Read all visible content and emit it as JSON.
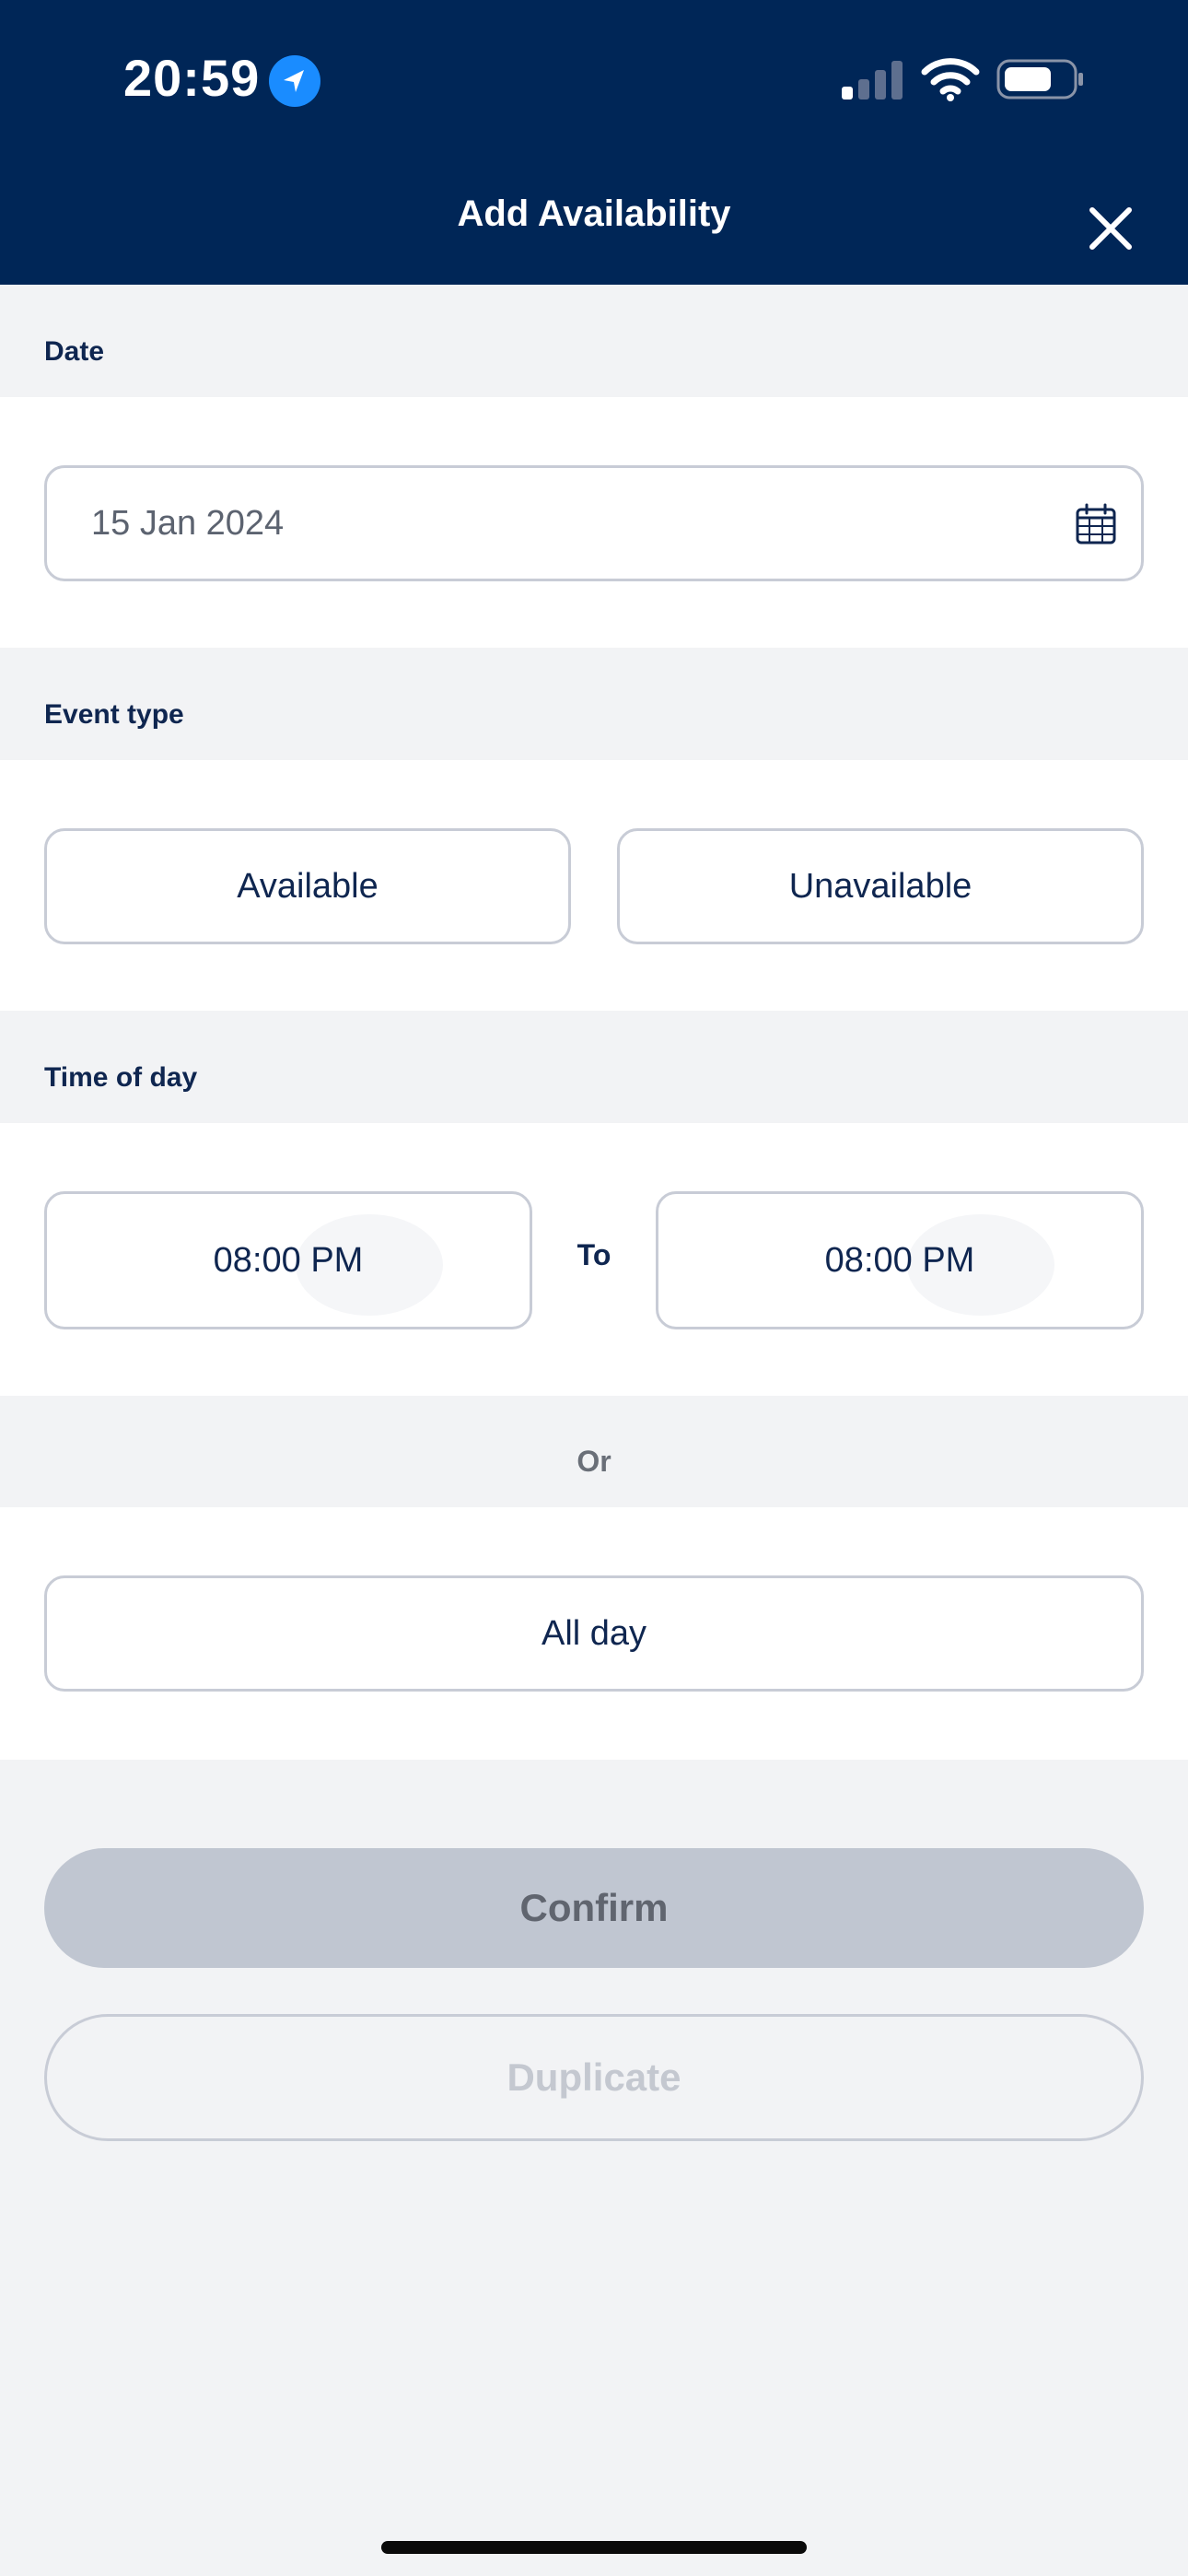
{
  "status_bar": {
    "time": "20:59",
    "icons": [
      "location-arrow-icon",
      "signal-icon",
      "wifi-icon",
      "battery-icon"
    ]
  },
  "header": {
    "title": "Add Availability",
    "close_icon": "close-icon",
    "background": "#002657"
  },
  "date_section": {
    "label": "Date",
    "value": "15 Jan 2024",
    "icon": "calendar-icon"
  },
  "event_type_section": {
    "label": "Event type",
    "options": [
      "Available",
      "Unavailable"
    ]
  },
  "time_section": {
    "label": "Time of day",
    "start_time": "08:00 PM",
    "separator": "To",
    "end_time": "08:00 PM"
  },
  "or_label": "Or",
  "all_day_label": "All day",
  "actions": {
    "confirm_label": "Confirm",
    "duplicate_label": "Duplicate"
  },
  "colors": {
    "accent": "#002657",
    "text_primary": "#0f2650",
    "disabled_button": "#c0c6d1"
  }
}
